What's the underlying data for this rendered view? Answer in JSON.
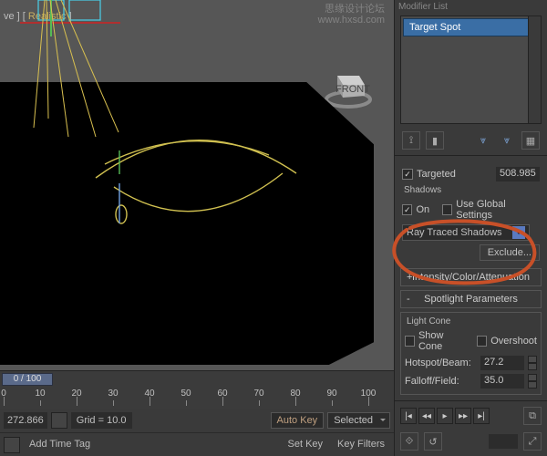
{
  "watermark": {
    "line1": "思缘设计论坛",
    "line2": "www.hxsd.com"
  },
  "viewport": {
    "label_prefix": "ve ] [ ",
    "label_mode": "Realistic",
    "label_suffix": " ]",
    "gizmo_front": "FRONT"
  },
  "timeline": {
    "marker": "0 / 100",
    "ticks": [
      0,
      10,
      20,
      30,
      40,
      50,
      60,
      70,
      80,
      90,
      100
    ]
  },
  "statusbar": {
    "coord": "272.866",
    "grid": "Grid = 10.0",
    "add_time_tag": "Add Time Tag",
    "autokey": "Auto Key",
    "selected": "Selected",
    "set_key": "Set Key",
    "key_filters": "Key Filters"
  },
  "modifier": {
    "label": "Modifier List",
    "selected": "Target Spot"
  },
  "toolbar_icons": [
    "pin-icon",
    "bar-icon",
    "fork1-icon",
    "fork2-icon",
    "grid-icon"
  ],
  "general": {
    "targeted_label": "Targeted",
    "targeted_value": "508.985",
    "shadows_label": "Shadows",
    "on_label": "On",
    "use_global_label": "Use Global Settings",
    "shadow_type": "Ray Traced Shadows",
    "exclude": "Exclude..."
  },
  "rollouts": {
    "intensity": "Intensity/Color/Attenuation",
    "spotlight": "Spotlight Parameters"
  },
  "lightcone": {
    "group": "Light Cone",
    "show_cone": "Show Cone",
    "overshoot": "Overshoot",
    "hotspot_label": "Hotspot/Beam:",
    "hotspot_value": "27.2",
    "falloff_label": "Falloff/Field:",
    "falloff_value": "35.0"
  }
}
